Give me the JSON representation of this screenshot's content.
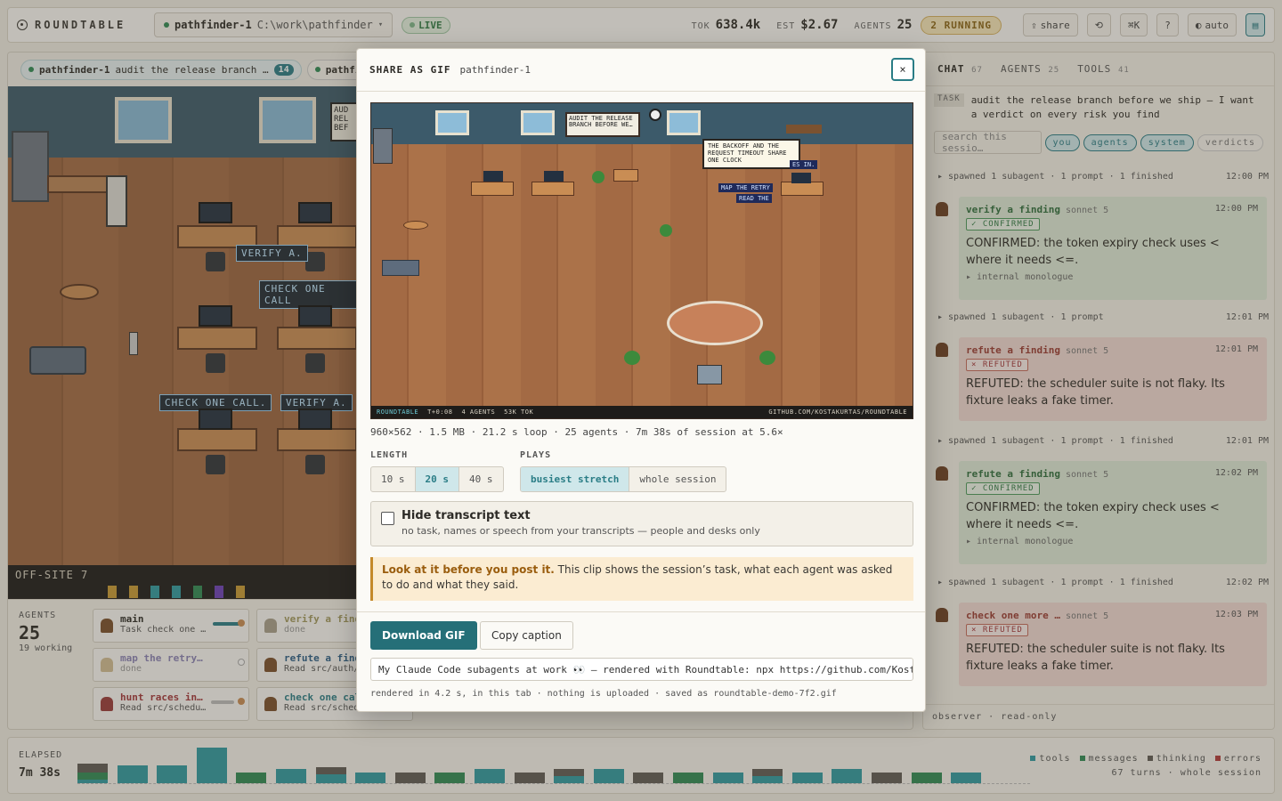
{
  "topbar": {
    "app_name": "ROUNDTABLE",
    "session_name": "pathfinder-1",
    "session_path": "C:\\work\\pathfinder",
    "live_label": "LIVE",
    "tok_label": "TOK",
    "tok_value": "638.4k",
    "est_label": "EST",
    "est_value": "$2.67",
    "agents_label": "AGENTS",
    "agents_value": "25",
    "running_label": "2 RUNNING",
    "share_label": "share",
    "kbd_label": "⌘K",
    "help_label": "?",
    "auto_label": "auto"
  },
  "session_tabs": [
    {
      "name": "pathfinder-1",
      "desc": "audit the release branch …",
      "count": "14"
    },
    {
      "name": "pathfi",
      "desc": "",
      "count": ""
    }
  ],
  "office": {
    "signs": [
      "VERIFY A.",
      "CHECK ONE CALL",
      "CHECK ONE CALL.",
      "VERIFY A."
    ],
    "board_text": "AUD REL BEF",
    "room_label": "OFF-SITE 7"
  },
  "agents_panel": {
    "label": "AGENTS",
    "count": "25",
    "working": "19 working",
    "cards": [
      {
        "title": "main",
        "sub": "Task check one …"
      },
      {
        "title": "verify a find",
        "sub": "done"
      },
      {
        "title": "map the retry…",
        "sub": "done"
      },
      {
        "title": "refute a find",
        "sub": "Read src/auth/m"
      },
      {
        "title": "hunt races in…",
        "sub": "Read src/schedu…"
      },
      {
        "title": "check one cal",
        "sub": "Read src/sched"
      }
    ]
  },
  "timeline": {
    "elapsed_label": "ELAPSED",
    "elapsed_value": "7m 38s",
    "legend": [
      "tools",
      "messages",
      "thinking",
      "errors"
    ],
    "summary": "67 turns · whole session",
    "colors": {
      "tools": "#2e9aa1",
      "messages": "#2f8a54",
      "thinking": "#5f5a55",
      "errors": "#b23a3a"
    }
  },
  "chat": {
    "tabs": [
      {
        "label": "CHAT",
        "count": "67"
      },
      {
        "label": "AGENTS",
        "count": "25"
      },
      {
        "label": "TOOLS",
        "count": "41"
      }
    ],
    "task_tag": "TASK",
    "task_text": "audit the release branch before we ship — I want a verdict on every risk you find",
    "search_placeholder": "search this sessio…",
    "filters": [
      "you",
      "agents",
      "system",
      "verdicts"
    ],
    "system_lines": [
      {
        "text": "▸  spawned 1 subagent · 1 prompt · 1 finished",
        "time": "12:00 PM"
      },
      {
        "text": "▸  spawned 1 subagent · 1 prompt",
        "time": "12:01 PM"
      },
      {
        "text": "▸  spawned 1 subagent · 1 prompt · 1 finished",
        "time": "12:01 PM"
      },
      {
        "text": "▸  spawned 1 subagent · 1 prompt · 1 finished",
        "time": "12:02 PM"
      }
    ],
    "messages": [
      {
        "title": "verify a finding",
        "model": "",
        "time": "12:00 PM",
        "badge": "✓ CONFIRMED",
        "text": "CONFIRMED: the token expiry check uses < where it needs <=.",
        "extra": "▸ internal monologue"
      },
      {
        "title": "refute a finding",
        "model": "sonnet 5",
        "time": "12:01 PM",
        "badge": "× REFUTED",
        "text": "REFUTED: the scheduler suite is not flaky. Its fixture leaks a fake timer.",
        "extra": ""
      },
      {
        "title": "refute a finding",
        "model": "sonnet 5",
        "time": "12:02 PM",
        "badge": "✓ CONFIRMED",
        "text": "CONFIRMED: the token expiry check uses < where it needs <=.",
        "extra": "▸ internal monologue"
      },
      {
        "title": "check one more …",
        "model": "sonnet 5",
        "time": "12:03 PM",
        "badge": "× REFUTED",
        "text": "REFUTED: the scheduler suite is not flaky. Its fixture leaks a fake timer.",
        "extra": ""
      }
    ],
    "first_model": "sonnet 5",
    "observer": "observer · read-only"
  },
  "modal": {
    "title": "SHARE AS GIF",
    "session": "pathfinder-1",
    "close": "×",
    "preview": {
      "board": "AUDIT THE RELEASE BRANCH BEFORE WE…",
      "bubble": "THE BACKOFF AND THE REQUEST TIMEOUT SHARE ONE CLOCK",
      "tags": [
        "MAP THE RETRY",
        "READ THE",
        "ES IN."
      ],
      "footer_brand": "ROUNDTABLE",
      "footer_time": "T+0:08",
      "footer_agents": "4 AGENTS",
      "footer_tok": "53K TOK",
      "footer_url": "GITHUB.COM/KOSTAKURTAS/ROUNDTABLE"
    },
    "meta": "960×562 · 1.5 MB · 21.2 s loop · 25 agents · 7m 38s of session at 5.6×",
    "length_label": "LENGTH",
    "length_options": [
      "10 s",
      "20 s",
      "40 s"
    ],
    "length_selected": "20 s",
    "plays_label": "PLAYS",
    "plays_options": [
      "busiest stretch",
      "whole session"
    ],
    "plays_selected": "busiest stretch",
    "hide_title": "Hide transcript text",
    "hide_desc": "no task, names or speech from your transcripts — people and desks only",
    "warn_bold": "Look at it before you post it.",
    "warn_text": " This clip shows the session’s task, what each agent was asked to do and what they said.",
    "download_label": "Download GIF",
    "copy_label": "Copy caption",
    "caption": "My Claude Code subagents at work 👀 — rendered with Roundtable: npx https://github.com/Kosta…",
    "footer": "rendered in 4.2 s, in this tab · nothing is uploaded · saved as roundtable-demo-7f2.gif"
  }
}
